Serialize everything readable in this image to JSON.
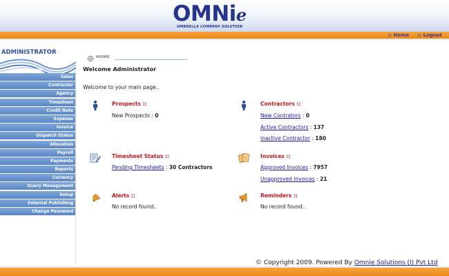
{
  "header": {
    "logo_word": "OMNi",
    "logo_e": "e",
    "logo_tagline": "UMBRELLA COMPANY SOLUTION"
  },
  "topnav": {
    "home": ":: Home",
    "logout": ":: Logout"
  },
  "sidebar": {
    "title": "ADMINISTRATOR",
    "items": [
      "Sales",
      "Contractor",
      "Agency",
      "Timesheet",
      "Credit Note",
      "Expense",
      "Invoice",
      "Dispatch Status",
      "Allocation",
      "Payroll",
      "Payments",
      "Reports",
      "Currency",
      "Query Management",
      "Setup",
      "External Publishing",
      "Change Password"
    ]
  },
  "breadcrumb": "HOME",
  "main": {
    "welcome_title": "Welcome Administrator",
    "welcome_text": "Welcome to your main page..",
    "prospects": {
      "title": "Prospects ::",
      "label": "New Prospects : ",
      "value": "0"
    },
    "contractors": {
      "title": "Contractors ::",
      "rows": [
        {
          "link": "New Contrators",
          "sep": " : ",
          "value": "0"
        },
        {
          "link": "Active Contractors",
          "sep": " : ",
          "value": "137"
        },
        {
          "link": "Inactive Contractor",
          "sep": " : ",
          "value": "180"
        }
      ]
    },
    "timesheet": {
      "title": "Timesheet Status ::",
      "link": "Pending Timesheets",
      "sep": " : ",
      "value": "30 Contractors"
    },
    "invoices": {
      "title": "Invoices ::",
      "rows": [
        {
          "link": "Approved Invoices",
          "sep": " : ",
          "value": "7957"
        },
        {
          "link": "Unapproved Invoices",
          "sep": " : ",
          "value": "21"
        }
      ]
    },
    "alerts": {
      "title": "Alerts ::",
      "text": "No record found.."
    },
    "reminders": {
      "title": "Reminders ::",
      "text": "No record found.."
    }
  },
  "footer": {
    "text": "© Copyright 2009. Powered By ",
    "link": "Omnie Solutions (I) Pvt Ltd"
  },
  "colors": {
    "brand_blue": "#26348c",
    "accent_orange": "#f0951e",
    "title_red": "#c4161c",
    "menu_blue": "#6a94cf",
    "link_blue": "#1a1aa8"
  }
}
